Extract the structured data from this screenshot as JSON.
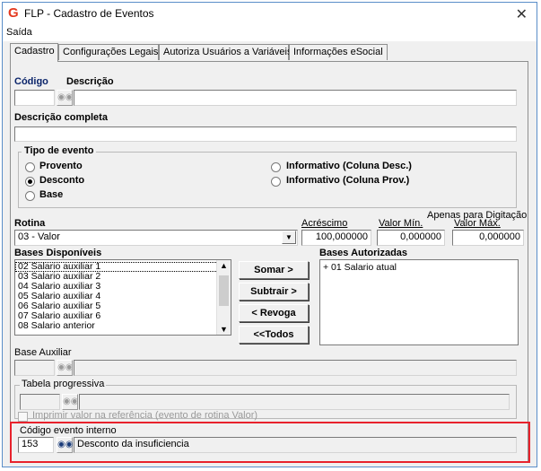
{
  "window": {
    "title": "FLP - Cadastro de Eventos",
    "close_glyph": "✕"
  },
  "menu": {
    "saida": "Saída"
  },
  "tabs": [
    "Cadastro",
    "Configurações Legais",
    "Autoriza Usuários a Variáveis",
    "Informações eSocial"
  ],
  "cadastro": {
    "codigo_label": "Código",
    "descricao_label": "Descrição",
    "codigo_value": "",
    "descricao_value": "",
    "descricao_completa_label": "Descrição completa",
    "descricao_completa_value": "",
    "tipo_evento": {
      "label": "Tipo de evento",
      "options": [
        "Provento",
        "Desconto",
        "Base",
        "Informativo (Coluna Desc.)",
        "Informativo (Coluna Prov.)"
      ],
      "selected": "Desconto"
    },
    "rotina_label": "Rotina",
    "rotina_value": "03 - Valor",
    "acrescimo_label": "Acréscimo",
    "acrescimo_value": "100,000000",
    "apenas_digitacao": "Apenas para Digitação",
    "valor_min_label": "Valor Mín.",
    "valor_min_value": "0,000000",
    "valor_max_label": "Valor Máx.",
    "valor_max_value": "0,000000",
    "bases_disponiveis_label": "Bases Disponíveis",
    "bases_disponiveis": [
      "02 Salario auxiliar 1",
      "03 Salario auxiliar 2",
      "04 Salario auxiliar 3",
      "05 Salario auxiliar 4",
      "06 Salario auxiliar 5",
      "07 Salario auxiliar 6",
      "08 Salario anterior"
    ],
    "bases_autorizadas_label": "Bases Autorizadas",
    "bases_autorizadas": [
      "+ 01 Salario atual"
    ],
    "buttons": {
      "somar": "Somar >",
      "subtrair": "Subtrair >",
      "revoga": "< Revoga",
      "todos": "<<Todos"
    },
    "base_auxiliar_label": "Base Auxiliar",
    "tabela_progressiva_label": "Tabela progressiva",
    "imprimir_label": "Imprimir valor na referência (evento de rotina Valor)",
    "codigo_interno_label": "Código evento interno",
    "codigo_interno_value": "153",
    "codigo_interno_desc": "Desconto da insuficiencia"
  },
  "colors": {
    "highlight": "#e8222c",
    "label_navy": "#0a246a",
    "logo": "#e43a20"
  }
}
